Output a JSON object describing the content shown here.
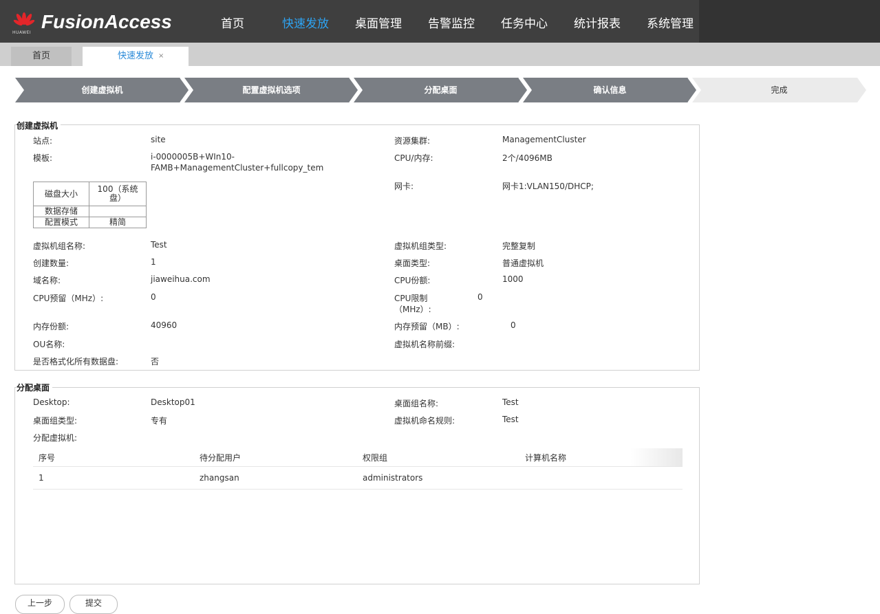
{
  "app": {
    "brand": "FusionAccess",
    "vendor": "HUAWEI",
    "nav": [
      "首页",
      "快速发放",
      "桌面管理",
      "告警监控",
      "任务中心",
      "统计报表",
      "系统管理"
    ],
    "active_nav": "快速发放",
    "accent_color": "#2ea3f2"
  },
  "tabs": {
    "home": "首页",
    "current": "快速发放",
    "close": "×"
  },
  "steps": [
    "创建虚拟机",
    "配置虚拟机选项",
    "分配桌面",
    "确认信息",
    "完成"
  ],
  "create_vm": {
    "title": "创建虚拟机",
    "site_label": "站点:",
    "site_value": "site",
    "cluster_label": "资源集群:",
    "cluster_value": "ManagementCluster",
    "template_label": "模板:",
    "template_value_1": "i-0000005B+WIn10-",
    "template_value_2": "FAMB+ManagementCluster+fullcopy_tem",
    "cpu_mem_label": "CPU/内存:",
    "cpu_mem_value": "2个/4096MB",
    "nic_label": "网卡:",
    "nic_value": "网卡1:VLAN150/DHCP;",
    "disk_table": {
      "size_label": "磁盘大小",
      "size_value_1": "100（系统",
      "size_value_2": "盘）",
      "storage_label": "数据存储",
      "storage_value": "",
      "mode_label": "配置模式",
      "mode_value": "精简"
    },
    "group_name_label": "虚拟机组名称:",
    "group_name_value": "Test",
    "group_type_label": "虚拟机组类型:",
    "group_type_value": "完整复制",
    "count_label": "创建数量:",
    "count_value": "1",
    "desktop_type_label": "桌面类型:",
    "desktop_type_value": "普通虚拟机",
    "domain_label": "域名称:",
    "domain_value": "jiaweihua.com",
    "cpu_share_label": "CPU份额:",
    "cpu_share_value": "1000",
    "cpu_reserve_label": "CPU预留（MHz）:",
    "cpu_reserve_value": "0",
    "cpu_limit_label_1": "CPU限制",
    "cpu_limit_label_2": "（MHz）:",
    "cpu_limit_value": "0",
    "mem_share_label": "内存份额:",
    "mem_share_value": "40960",
    "mem_reserve_label": "内存预留（MB）:",
    "mem_reserve_value": "0",
    "ou_label": "OU名称:",
    "ou_value": "",
    "vm_prefix_label": "虚拟机名称前缀:",
    "vm_prefix_value": "",
    "format_label": "是否格式化所有数据盘:",
    "format_value": "否"
  },
  "assign_desktop": {
    "title": "分配桌面",
    "desktop_label": "Desktop:",
    "desktop_value": "Desktop01",
    "group_name_label": "桌面组名称:",
    "group_name_value": "Test",
    "group_type_label": "桌面组类型:",
    "group_type_value": "专有",
    "naming_rule_label": "虚拟机命名规则:",
    "naming_rule_value": "Test",
    "assign_vm_label": "分配虚拟机:",
    "table": {
      "headers": [
        "序号",
        "待分配用户",
        "权限组",
        "计算机名称"
      ],
      "rows": [
        [
          "1",
          "zhangsan",
          "administrators",
          ""
        ]
      ]
    }
  },
  "buttons": {
    "prev": "上一步",
    "submit": "提交"
  }
}
